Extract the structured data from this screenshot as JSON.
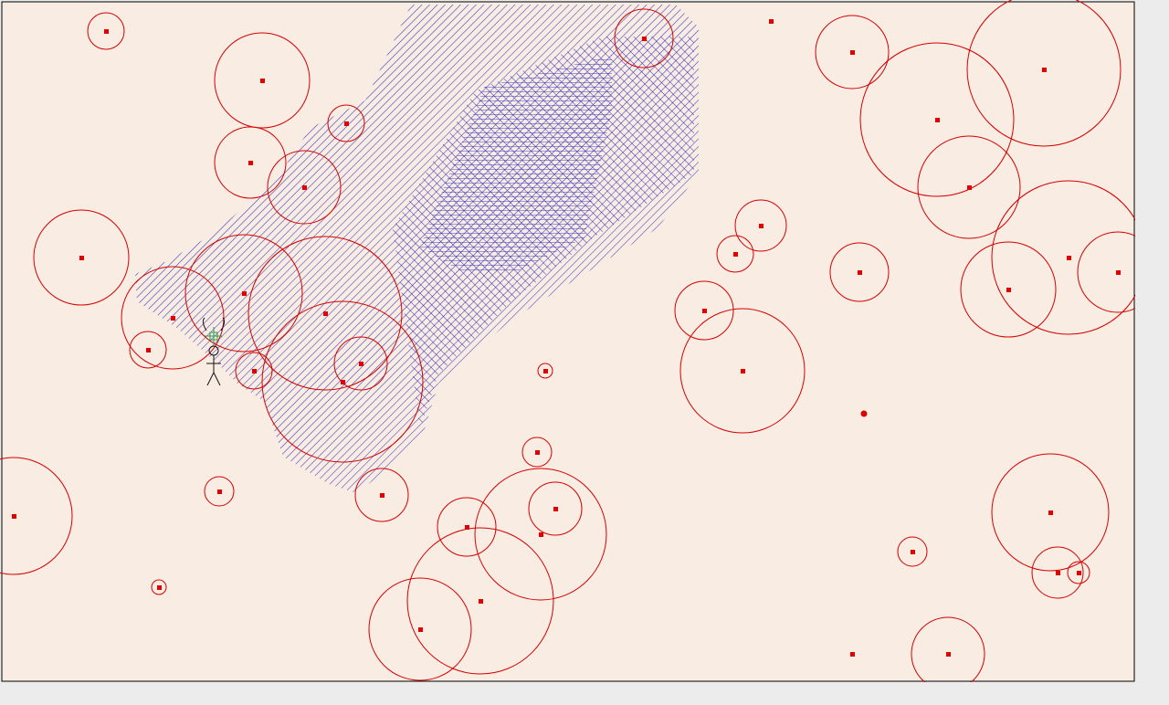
{
  "app": {
    "title": "",
    "colors": {
      "background": "#f9ece3",
      "frame": "#ececec",
      "border": "#000000",
      "obstacle": "#d40000",
      "center": "#e00000",
      "search_tree": "#1a1ab4",
      "agent": "#111111",
      "agent_goal": "#2a9a4a"
    }
  },
  "scene": {
    "obstacles_count": 46,
    "agent": {
      "icon": "stick-figure-icon",
      "marker_icon": "target-marker-icon"
    },
    "search_region": {
      "icon": "hatched-search-region"
    }
  }
}
